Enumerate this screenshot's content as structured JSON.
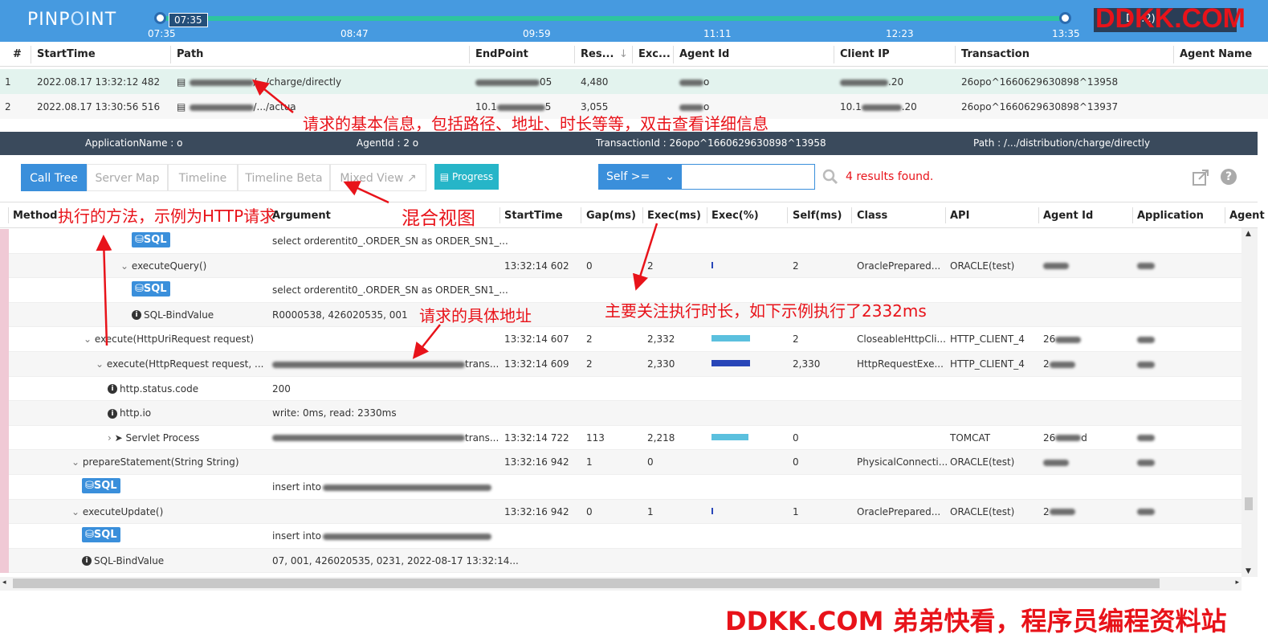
{
  "app": {
    "logo_left": "PINP",
    "logo_o": "O",
    "logo_right": "INT"
  },
  "timeline": {
    "current": "07:35",
    "ticks": [
      "07:35",
      "08:47",
      "09:59",
      "11:11",
      "12:23",
      "13:35"
    ],
    "watermark_box": "D (.2)",
    "watermark": "DDKK.COM"
  },
  "transactions": {
    "headers": [
      "#",
      "StartTime",
      "Path",
      "EndPoint",
      "Res...",
      "Exc...",
      "Agent Id",
      "Client IP",
      "Transaction",
      "Agent Name"
    ],
    "sort_icon": "arrow-down",
    "rows": [
      {
        "num": "1",
        "start": "2022.08.17 13:32:12 482",
        "path": "/.../charge/directly",
        "endpoint_tail": "05",
        "res": "4,480",
        "agent_tail": "o",
        "client_tail": ".20",
        "transaction": "26opo^1660629630898^13958"
      },
      {
        "num": "2",
        "start": "2022.08.17 13:30:56 516",
        "path": "/.../actua",
        "endpoint_head": "10.1",
        "endpoint_tail": "5",
        "res": "3,055",
        "agent_tail": "o",
        "client_head": "10.1",
        "client_tail": ".20",
        "transaction": "26opo^1660629630898^13937"
      }
    ]
  },
  "annotations": {
    "basic": "请求的基本信息，包括路径、地址、时长等等，双击查看详细信息",
    "method": "执行的方法，示例为HTTP请求",
    "mixed": "混合视图",
    "address": "请求的具体地址",
    "exec": "主要关注执行时长，如下示例执行了2332ms"
  },
  "infobar": {
    "application": "ApplicationName : o",
    "agent": "AgentId : 2 o",
    "transaction": "TransactionId : 26opo^1660629630898^13958",
    "path": "Path : /.../distribution/charge/directly"
  },
  "tabs": [
    "Call Tree",
    "Server Map",
    "Timeline",
    "Timeline Beta",
    "Mixed View"
  ],
  "toolbar": {
    "progress": "Progress",
    "self_filter": "Self >=",
    "search_value": "",
    "results": "4 results found."
  },
  "grid": {
    "headers": [
      "Method",
      "Argument",
      "StartTime",
      "Gap(ms)",
      "Exec(ms)",
      "Exec(%)",
      "Self(ms)",
      "Class",
      "API",
      "Agent Id",
      "Application",
      "Agent"
    ],
    "rows": [
      {
        "type": "sql",
        "indent": 164,
        "arg": "select orderentit0_.ORDER_SN as ORDER_SN1_..."
      },
      {
        "type": "method",
        "indent": 150,
        "method": "executeQuery()",
        "start": "13:32:14 602",
        "gap": "0",
        "exec": "2",
        "bar": 0,
        "self": "2",
        "cls": "OraclePrepared...",
        "api": "ORACLE(test)"
      },
      {
        "type": "sql",
        "indent": 164,
        "arg": "select orderentit0_.ORDER_SN as ORDER_SN1_..."
      },
      {
        "type": "info",
        "indent": 164,
        "method": "SQL-BindValue",
        "arg": "R0000538, 426020535, 001"
      },
      {
        "type": "method",
        "indent": 104,
        "method": "execute(HttpUriRequest request)",
        "start": "13:32:14 607",
        "gap": "2",
        "exec": "2,332",
        "bar": 48,
        "self": "2",
        "cls": "CloseableHttpCli...",
        "api": "HTTP_CLIENT_4",
        "agent_head": "26"
      },
      {
        "type": "method",
        "indent": 119,
        "method": "execute(HttpRequest request, ...",
        "arg_tail": "trans...",
        "start": "13:32:14 609",
        "gap": "2",
        "exec": "2,330",
        "bar": 48,
        "bardark": true,
        "self": "2,330",
        "cls": "HttpRequestExe...",
        "api": "HTTP_CLIENT_4",
        "agent_head": "2"
      },
      {
        "type": "info",
        "indent": 134,
        "method": "http.status.code",
        "arg": "200"
      },
      {
        "type": "info",
        "indent": 134,
        "method": "http.io",
        "arg": "write: 0ms, read: 2330ms"
      },
      {
        "type": "servlet",
        "indent": 134,
        "method": "Servlet Process",
        "arg_tail": "trans...",
        "start": "13:32:14 722",
        "gap": "113",
        "exec": "2,218",
        "bar": 46,
        "self": "0",
        "cls": "",
        "api": "TOMCAT",
        "agent_head": "26",
        "agent_tail": "d"
      },
      {
        "type": "method",
        "indent": 89,
        "method": "prepareStatement(String String)",
        "start": "13:32:16 942",
        "gap": "1",
        "exec": "0",
        "bar": -1,
        "self": "0",
        "cls": "PhysicalConnecti...",
        "api": "ORACLE(test)"
      },
      {
        "type": "sql",
        "indent": 102,
        "arg": "insert into"
      },
      {
        "type": "method",
        "indent": 89,
        "method": "executeUpdate()",
        "start": "13:32:16 942",
        "gap": "0",
        "exec": "1",
        "bar": 0,
        "self": "1",
        "cls": "OraclePrepared...",
        "api": "ORACLE(test)",
        "agent_head": "2"
      },
      {
        "type": "sql",
        "indent": 102,
        "arg": "insert into"
      },
      {
        "type": "info",
        "indent": 102,
        "method": "SQL-BindValue",
        "arg": "07, 001, 426020535, 0231, 2022-08-17 13:32:14..."
      }
    ]
  },
  "footer": "DDKK.COM 弟弟快看，程序员编程资料站",
  "colors": {
    "topbar": "#469ae0",
    "track": "#2ec4a0",
    "accent": "#3a8fdb",
    "annotation": "#e8131a",
    "infobar": "#3a4a5c",
    "selected_row": "#e3f3ee"
  }
}
